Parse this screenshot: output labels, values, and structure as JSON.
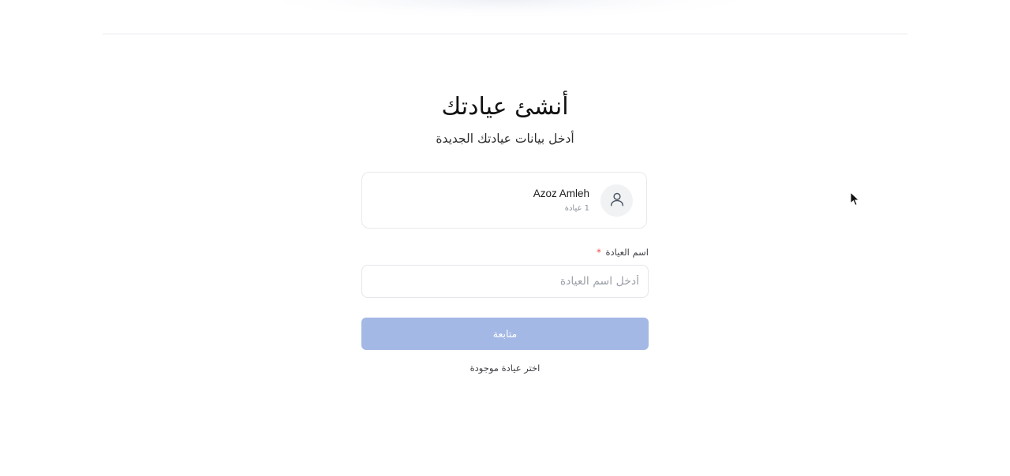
{
  "header": {
    "title": "أنشئ عيادتك",
    "subtitle": "أدخل بيانات عيادتك الجديدة"
  },
  "user_card": {
    "name": "Azoz Amleh",
    "clinic_count": "1 عيادة",
    "avatar_icon": "user-icon"
  },
  "form": {
    "clinic_name_label": "اسم العيادة",
    "required_marker": "*",
    "clinic_name_placeholder": "أدخل اسم العيادة",
    "clinic_name_value": ""
  },
  "actions": {
    "continue_label": "متابعة",
    "choose_existing_label": "اختر عيادة موجودة"
  },
  "colors": {
    "primary_disabled": "#a3b8e4",
    "required": "#ef4444"
  }
}
